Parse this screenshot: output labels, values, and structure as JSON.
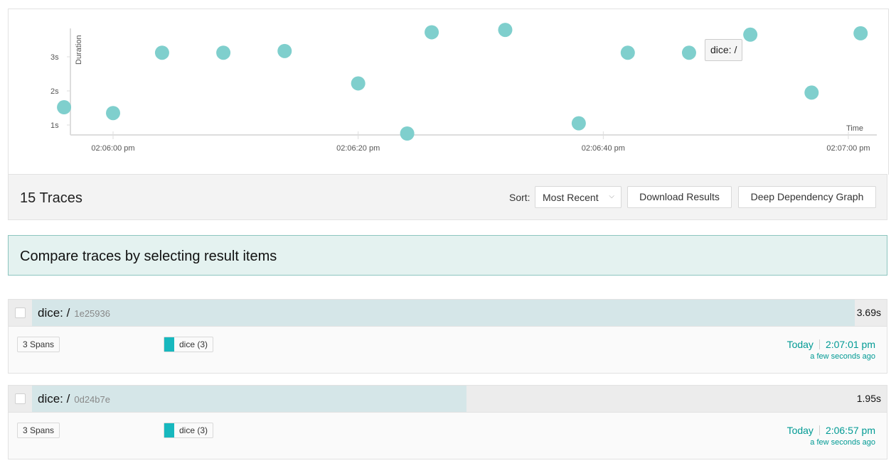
{
  "chart_data": {
    "type": "scatter",
    "ylabel": "Duration",
    "xlabel": "Time",
    "y_ticks": [
      "1s",
      "2s",
      "3s"
    ],
    "x_ticks": [
      "02:06:00 pm",
      "02:06:20 pm",
      "02:06:40 pm",
      "02:07:00 pm"
    ],
    "series": [
      {
        "color": "#7fcfcd",
        "points": [
          {
            "x": "02:05:56 pm",
            "y": 1.52
          },
          {
            "x": "02:06:00 pm",
            "y": 1.35
          },
          {
            "x": "02:06:04 pm",
            "y": 3.12
          },
          {
            "x": "02:06:09 pm",
            "y": 3.12
          },
          {
            "x": "02:06:14 pm",
            "y": 3.17
          },
          {
            "x": "02:06:20 pm",
            "y": 2.22
          },
          {
            "x": "02:06:24 pm",
            "y": 0.75
          },
          {
            "x": "02:06:26 pm",
            "y": 3.72
          },
          {
            "x": "02:06:32 pm",
            "y": 3.79
          },
          {
            "x": "02:06:38 pm",
            "y": 1.05
          },
          {
            "x": "02:06:42 pm",
            "y": 3.12
          },
          {
            "x": "02:06:47 pm",
            "y": 3.12
          },
          {
            "x": "02:06:52 pm",
            "y": 3.65
          },
          {
            "x": "02:06:57 pm",
            "y": 1.95
          },
          {
            "x": "02:07:01 pm",
            "y": 3.69
          }
        ]
      }
    ]
  },
  "tooltip": "dice: /",
  "results": {
    "count_label": "15 Traces",
    "sort_label": "Sort:",
    "sort_value": "Most Recent",
    "download_label": "Download Results",
    "ddg_label": "Deep Dependency Graph"
  },
  "compare_banner": "Compare traces by selecting result items",
  "traces": [
    {
      "name": "dice: /",
      "id": "1e25936",
      "duration": "3.69s",
      "duration_fraction": 1.0,
      "spans": "3 Spans",
      "service": "dice (3)",
      "service_color": "#17b8be",
      "day": "Today",
      "time": "2:07:01 pm",
      "ago": "a few seconds ago"
    },
    {
      "name": "dice: /",
      "id": "0d24b7e",
      "duration": "1.95s",
      "duration_fraction": 0.528,
      "spans": "3 Spans",
      "service": "dice (3)",
      "service_color": "#17b8be",
      "day": "Today",
      "time": "2:06:57 pm",
      "ago": "a few seconds ago"
    }
  ]
}
